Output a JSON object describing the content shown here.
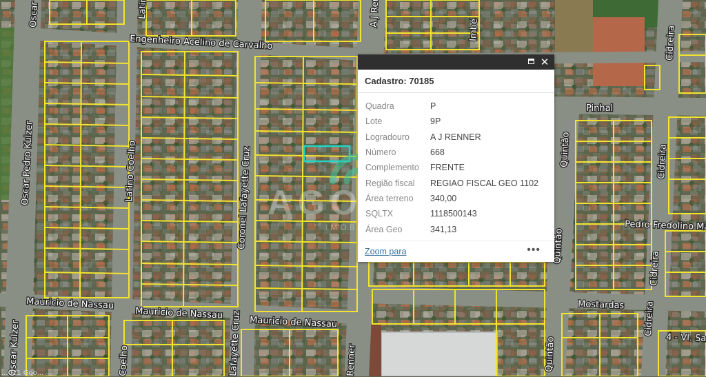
{
  "map": {
    "streets": {
      "engenheiro": "Engenheiro Acelino de Carvalho",
      "pinhal": "Pinhal",
      "mostardas": "Mostardas",
      "nassau_left": "Mauricio de Nassau",
      "nassau_mid": "Mauricio de Nassau",
      "nassau_right": "Mauricio de Nassau",
      "oscar_pedro_kulzer": "Oscar Pedro Kulzer",
      "oscar_top": "Oscar",
      "oscar_kulzer_bottom": "Oscar Kulzer",
      "latino_coelho": "Latino Coelho",
      "latino_top": "Latino",
      "coelho_bottom": "Coelho",
      "coronel_lafayette_cruz": "Coronel Lafayette Cruz",
      "lafayette_cruz_bottom": "Lafayette Cruz",
      "aj_renner_top": "A J Renner",
      "renner_bottom": "Renner",
      "imbe": "Imbé",
      "quintao_mid": "Quintão",
      "quintao_low": "Quintão",
      "quintao_bottom": "Quintão",
      "cidreira_top": "Cidreira",
      "cidreira_mid": "Cidreira",
      "cidreira_low": "Cidreira",
      "cidreira_bottom": "Cidreira",
      "pedro_fredolino": "Pedro Fredolino Ma",
      "vsan": "4 - Vl. San"
    },
    "credit": "...021 Goo..."
  },
  "watermark": {
    "brand": "AGORA",
    "sub": "IMOBILIÁRIA"
  },
  "popup": {
    "title": "Cadastro: 70185",
    "fields": [
      {
        "key": "Quadra",
        "value": "P"
      },
      {
        "key": "Lote",
        "value": "9P"
      },
      {
        "key": "Logradouro",
        "value": "A J RENNER"
      },
      {
        "key": "Número",
        "value": "668"
      },
      {
        "key": "Complemento",
        "value": "FRENTE"
      },
      {
        "key": "Região fiscal",
        "value": "REGIAO FISCAL GEO 1102"
      },
      {
        "key": "Área terreno",
        "value": "340,00"
      },
      {
        "key": "SQLTX",
        "value": "1118500143"
      },
      {
        "key": "Área Geo",
        "value": "341,13"
      }
    ],
    "zoom_label": "Zoom para",
    "more_label": "•••",
    "maximize_icon": "maximize-icon",
    "close_icon": "close-icon",
    "close_glyph": "✕"
  },
  "colors": {
    "parcel": "#f2e32f",
    "selected_parcel": "#1fd6c8",
    "road": "#8a8f86"
  }
}
